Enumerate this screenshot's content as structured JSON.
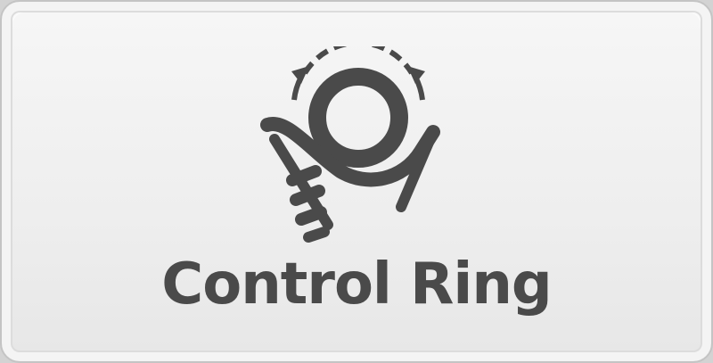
{
  "button": {
    "label": "Control Ring",
    "icon": "control-ring-icon"
  },
  "colors": {
    "icon": "#4a4a4a",
    "text": "#4a4a4a",
    "face": "#f0f0f0",
    "border": "#c4c4c4"
  }
}
